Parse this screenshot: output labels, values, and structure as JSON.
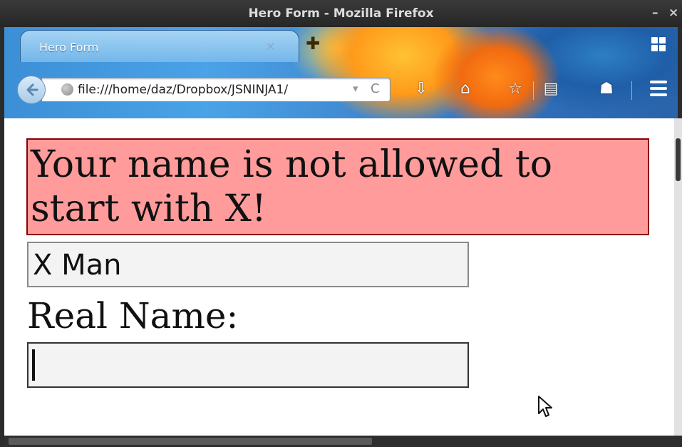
{
  "window": {
    "title": "Hero Form - Mozilla Firefox",
    "minimize": "–",
    "close": "×"
  },
  "tabs": [
    {
      "label": "Hero Form",
      "close": "×"
    }
  ],
  "toolbar": {
    "url": "file:///home/daz/Dropbox/JSNINJA1/",
    "url_dropdown": "▾",
    "reload": "C"
  },
  "page": {
    "error_message": "Your name is not allowed to start with X!",
    "hero_name_value": "X Man",
    "real_name_label": "Real Name:",
    "real_name_value": ""
  },
  "colors": {
    "error_background": "#ff9b9b",
    "error_border": "#8b0000"
  }
}
